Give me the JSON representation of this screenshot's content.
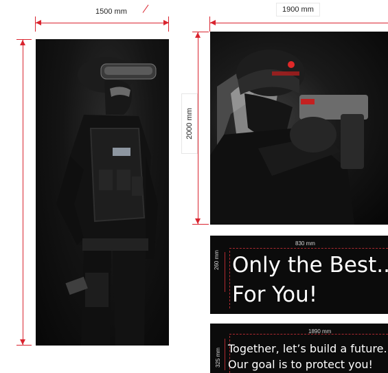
{
  "dimensions": {
    "left_width": "1500 mm",
    "right_width": "1900 mm",
    "right_height": "2000 mm",
    "banner1_width": "830 mm",
    "banner1_height": "260 mm",
    "banner2_width": "1890 mm",
    "banner2_height": "325 mm"
  },
  "banner1": {
    "line1": "Only the Best...",
    "line2": "For You!"
  },
  "banner2": {
    "line1": "Together, let’s build a future...",
    "line2": "Our goal is to protect you!"
  },
  "colors": {
    "dimension_line": "#d9232e",
    "panel_background": "#0a0a0a",
    "banner_text": "#ffffff"
  }
}
